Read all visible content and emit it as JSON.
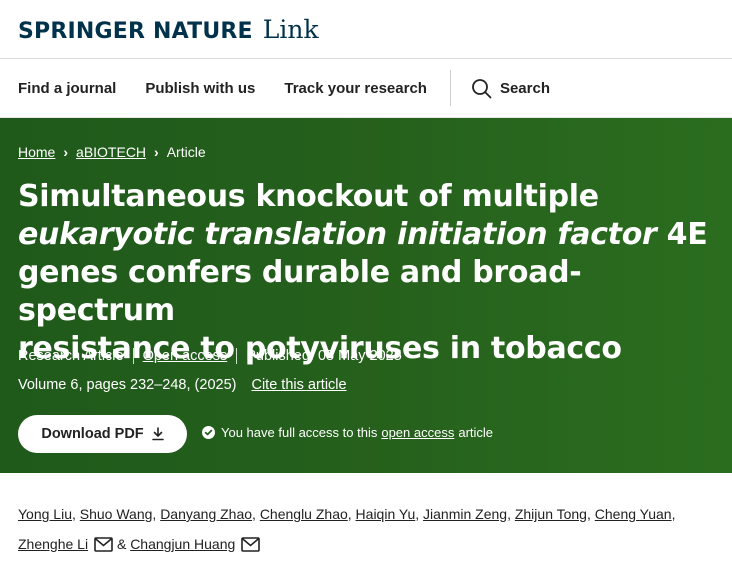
{
  "header": {
    "brand": "SPRINGER NATURE",
    "product": "Link"
  },
  "nav": {
    "find_journal": "Find a journal",
    "publish": "Publish with us",
    "track": "Track your research",
    "search": "Search"
  },
  "breadcrumb": [
    "Home",
    "aBIOTECH",
    "Article"
  ],
  "article": {
    "title_line1": "Simultaneous knockout of multiple",
    "title_italic": "eukaryotic translation initiation factor",
    "title_after_italic": " 4E",
    "title_line3": "genes confers durable and broad-spectrum",
    "title_line4": "resistance to potyviruses in tobacco",
    "type": "Research Article",
    "open_access": "Open access",
    "published": "Published: 05 May 2025",
    "volume": "Volume 6, pages 232–248, (2025)",
    "cite": "Cite this article",
    "download_label": "Download PDF",
    "access_prefix": "You have full access to this",
    "access_link": "open access",
    "access_suffix": "article"
  },
  "authors": [
    "Yong Liu",
    "Shuo Wang",
    "Danyang Zhao",
    "Chenglu Zhao",
    "Haiqin Yu",
    "Jianmin Zeng",
    "Zhijun Tong",
    "Cheng Yuan",
    "Zhenghe Li",
    "Changjun Huang"
  ],
  "author_separator": ",",
  "author_and": "&",
  "colors": {
    "hero_green": "#255f1c",
    "brand_navy": "#01324b"
  },
  "icons": [
    "search-icon",
    "download-icon",
    "check-circle-icon",
    "mail-icon"
  ]
}
